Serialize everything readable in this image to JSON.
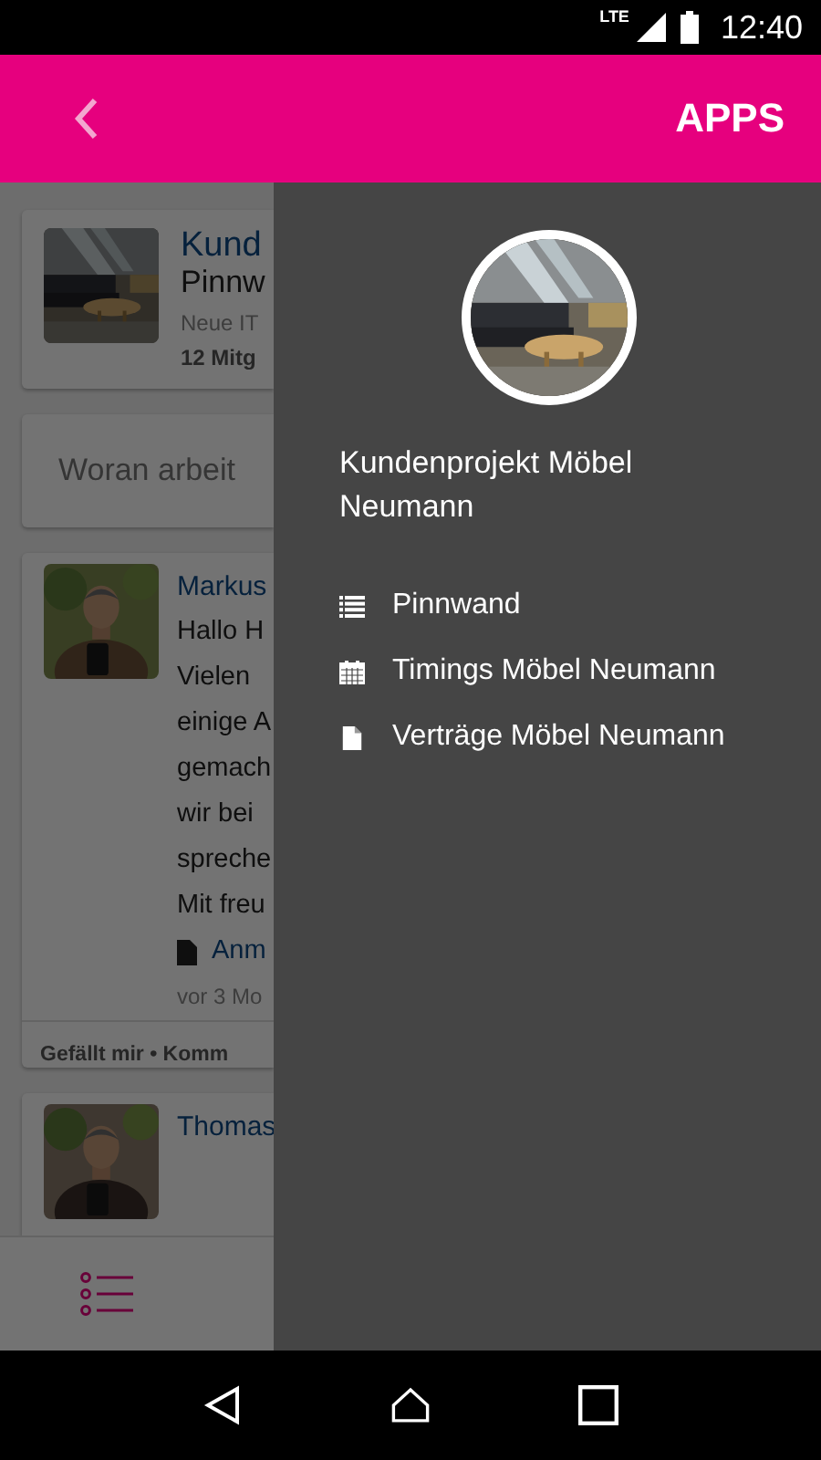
{
  "status_bar": {
    "network": "LTE",
    "time": "12:40"
  },
  "app_bar": {
    "action": "APPS"
  },
  "feed": {
    "group_card": {
      "title": "Kund",
      "subtitle": "Pinnw",
      "description": "Neue IT",
      "members": "12 Mitg"
    },
    "composer": {
      "placeholder": "Woran arbeit"
    },
    "posts": [
      {
        "author": "Markus",
        "lines": [
          "Hallo H",
          "Vielen",
          "einige A",
          "gemach",
          "wir bei",
          "spreche",
          "Mit freu"
        ],
        "attachment": "Anm",
        "time": "vor 3 Mo",
        "actions": "Gefällt mir • Komm"
      },
      {
        "author": "Thomas"
      }
    ]
  },
  "bottom_tabs": [
    {
      "kind": "list",
      "selected": true
    }
  ],
  "drawer": {
    "title": "Kundenprojekt Möbel Neumann",
    "items": [
      {
        "kind": "list",
        "label": "Pinnwand"
      },
      {
        "kind": "calendar",
        "label": "Timings Möbel Neumann"
      },
      {
        "kind": "document",
        "label": "Verträge Möbel Neumann"
      }
    ]
  }
}
